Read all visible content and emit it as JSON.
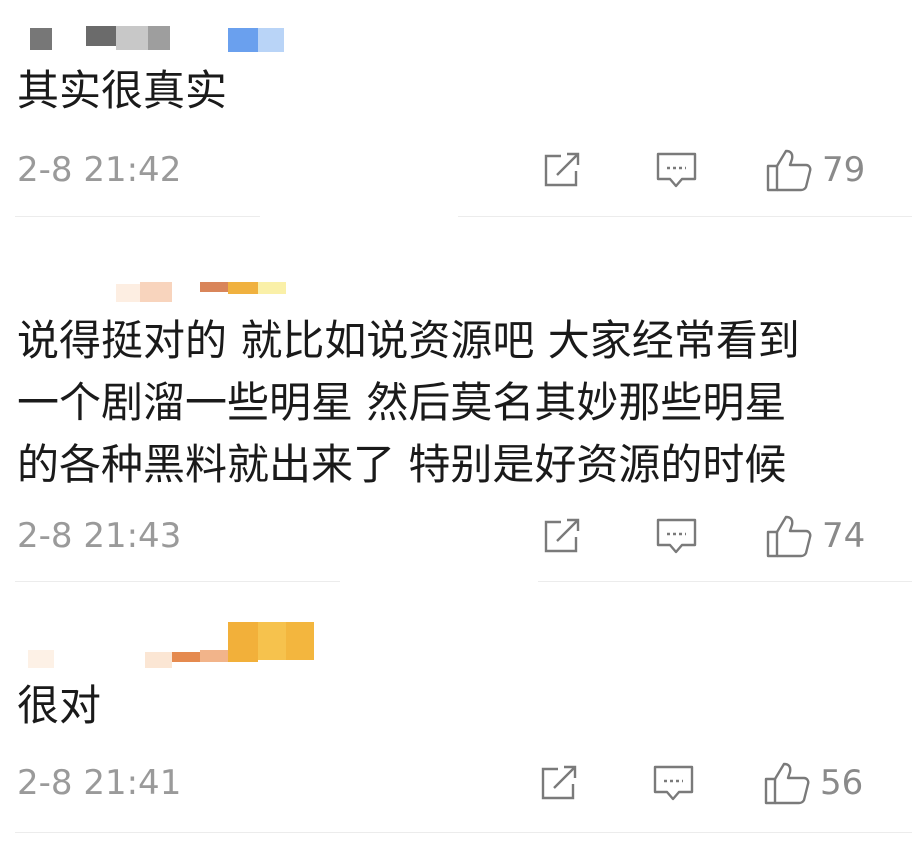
{
  "comments": [
    {
      "text": "其实很真实",
      "time": "2-8 21:42",
      "likes": "79"
    },
    {
      "text": "说得挺对的 就比如说资源吧 大家经常看到\n一个剧溜一些明星 然后莫名其妙那些明星\n的各种黑料就出来了 特别是好资源的时候",
      "time": "2-8 21:43",
      "likes": "74"
    },
    {
      "text": "很对",
      "time": "2-8 21:41",
      "likes": "56"
    }
  ],
  "icons": {
    "share": "share-icon",
    "reply": "reply-icon",
    "like": "thumbs-up-icon"
  },
  "colors": {
    "text": "#1a1a1a",
    "meta": "#9a9a9a",
    "divider": "#ececec"
  }
}
